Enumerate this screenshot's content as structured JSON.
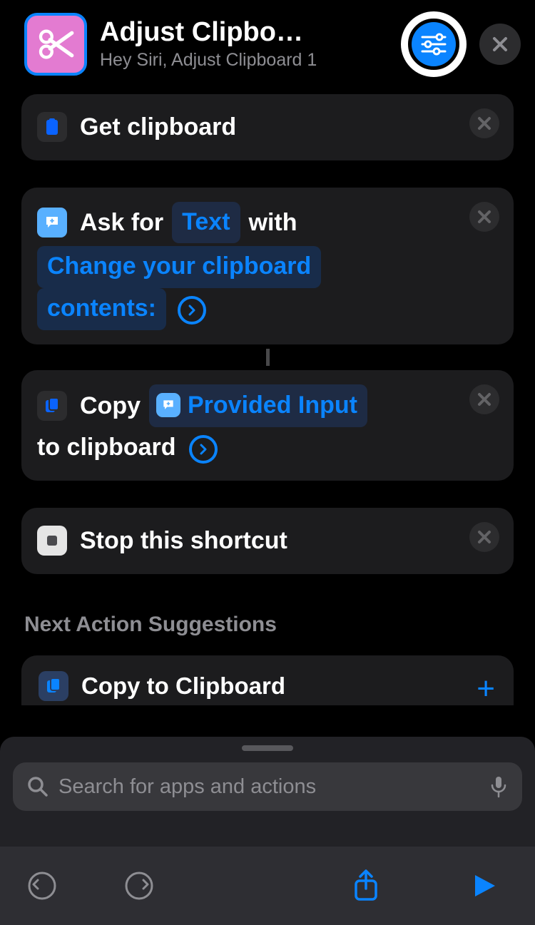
{
  "header": {
    "title": "Adjust Clipbo…",
    "subtitle": "Hey Siri, Adjust Clipboard 1"
  },
  "actions": {
    "get_clipboard": {
      "label": "Get clipboard"
    },
    "ask": {
      "prefix": "Ask for",
      "type_token": "Text",
      "mid": "with",
      "prompt_line1": "Change your clipboard",
      "prompt_line2": "contents:"
    },
    "copy": {
      "prefix": "Copy",
      "input_token": "Provided Input",
      "suffix": "to clipboard"
    },
    "stop": {
      "label": "Stop this shortcut"
    }
  },
  "suggestions": {
    "heading": "Next Action Suggestions",
    "item_label": "Copy to Clipboard"
  },
  "search": {
    "placeholder": "Search for apps and actions"
  }
}
